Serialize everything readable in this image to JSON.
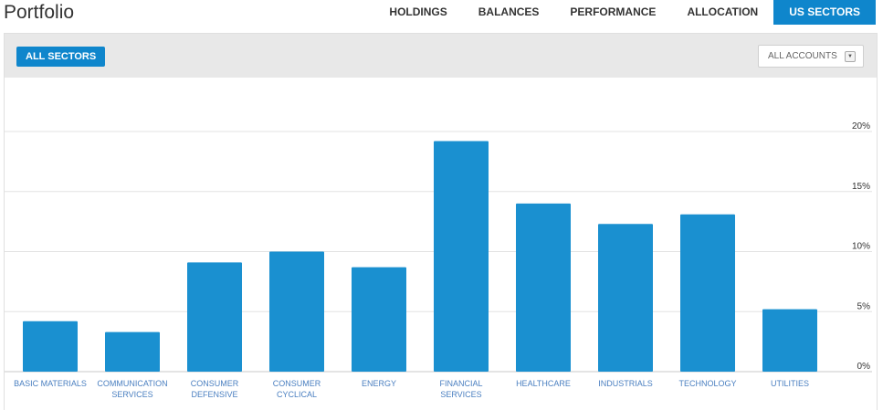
{
  "app": {
    "title": "Portfolio"
  },
  "nav": {
    "tabs": [
      {
        "label": "HOLDINGS",
        "active": false
      },
      {
        "label": "BALANCES",
        "active": false
      },
      {
        "label": "PERFORMANCE",
        "active": false
      },
      {
        "label": "ALLOCATION",
        "active": false
      },
      {
        "label": "US SECTORS",
        "active": true
      }
    ]
  },
  "toolbar": {
    "sector_button": "ALL SECTORS",
    "accounts_select": "ALL ACCOUNTS"
  },
  "colors": {
    "accent": "#0f86cc",
    "bar": "#1a90d0",
    "label": "#4a7fc0"
  },
  "chart_data": {
    "type": "bar",
    "categories": [
      "BASIC MATERIALS",
      "COMMUNICATION SERVICES",
      "CONSUMER DEFENSIVE",
      "CONSUMER CYCLICAL",
      "ENERGY",
      "FINANCIAL SERVICES",
      "HEALTHCARE",
      "INDUSTRIALS",
      "TECHNOLOGY",
      "UTILITIES"
    ],
    "category_lines": [
      [
        "BASIC MATERIALS"
      ],
      [
        "COMMUNICATION",
        "SERVICES"
      ],
      [
        "CONSUMER",
        "DEFENSIVE"
      ],
      [
        "CONSUMER",
        "CYCLICAL"
      ],
      [
        "ENERGY"
      ],
      [
        "FINANCIAL",
        "SERVICES"
      ],
      [
        "HEALTHCARE"
      ],
      [
        "INDUSTRIALS"
      ],
      [
        "TECHNOLOGY"
      ],
      [
        "UTILITIES"
      ]
    ],
    "values": [
      4.2,
      3.3,
      9.1,
      10.0,
      8.7,
      19.2,
      14.0,
      12.3,
      13.1,
      5.2
    ],
    "unit": "%",
    "ylim": [
      0,
      20
    ],
    "yticks": [
      0,
      5,
      10,
      15,
      20
    ],
    "ytick_labels": [
      "0%",
      "5%",
      "10%",
      "15%",
      "20%"
    ],
    "y_axis_side": "right",
    "grid": true,
    "legend": "none"
  }
}
